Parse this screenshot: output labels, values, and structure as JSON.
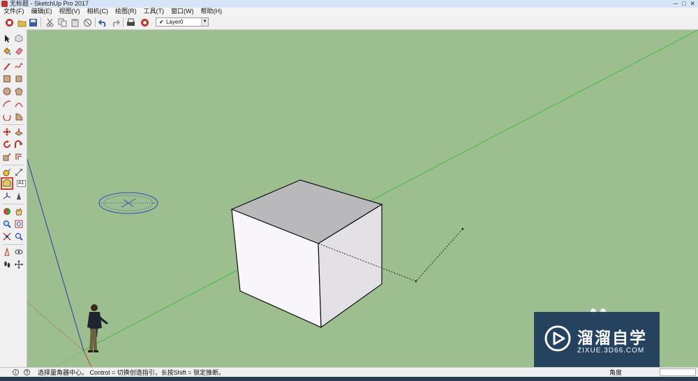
{
  "window": {
    "title": "无标题 - SketchUp Pro 2017",
    "controls": [
      "minimize-icon",
      "maximize-icon",
      "close-icon"
    ]
  },
  "menu": [
    "文件(F)",
    "编辑(E)",
    "视图(V)",
    "相机(C)",
    "绘图(R)",
    "工具(T)",
    "窗口(W)",
    "帮助(H)"
  ],
  "toolbar": {
    "icons": [
      "getting-started-icon",
      "open-icon",
      "save-icon",
      "cut-icon",
      "copy-icon",
      "paste-icon",
      "erase-icon",
      "undo-icon",
      "redo-icon",
      "print-icon",
      "model-info-icon"
    ],
    "layer": {
      "check": "✔",
      "value": "Layer0"
    }
  },
  "left_toolbar": {
    "selected_tool": "protractor-tool",
    "tooltip": "A1"
  },
  "status_bar": {
    "message": "选择量角器中心。 Control = 切换创造指引，长按Shift = 锁定推断。",
    "measure_label": "角度",
    "measure_value": ""
  },
  "watermark": {
    "main": "溜溜自学",
    "sub": "ZIXUE.3D66.COM"
  },
  "colors": {
    "sky_ground": "#9dbf8f",
    "red_axis": "#c0392b",
    "green_axis": "#3fbf3f",
    "blue_axis": "#3a4fa0",
    "protractor": "#2b4fb5"
  }
}
